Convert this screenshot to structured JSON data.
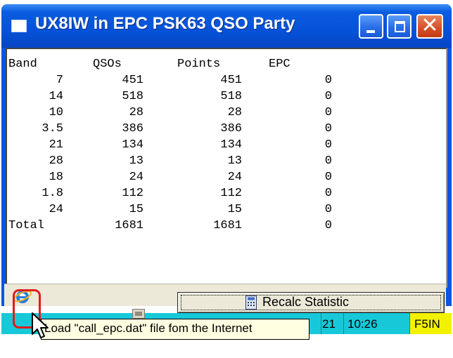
{
  "window": {
    "title": "UX8IW in EPC PSK63 QSO Party"
  },
  "stats_table": {
    "headers": [
      "Band",
      "QSOs",
      "Points",
      "EPC"
    ],
    "rows": [
      [
        "7",
        "451",
        "451",
        "0"
      ],
      [
        "14",
        "518",
        "518",
        "0"
      ],
      [
        "10",
        "28",
        "28",
        "0"
      ],
      [
        "3.5",
        "386",
        "386",
        "0"
      ],
      [
        "21",
        "134",
        "134",
        "0"
      ],
      [
        "28",
        "13",
        "13",
        "0"
      ],
      [
        "18",
        "24",
        "24",
        "0"
      ],
      [
        "1.8",
        "112",
        "112",
        "0"
      ],
      [
        "24",
        "15",
        "15",
        "0"
      ]
    ],
    "total": [
      "Total",
      "1681",
      "1681",
      "0"
    ]
  },
  "toolbar": {
    "recalc_label": "Recalc Statistic",
    "web_icon": "internet-explorer-icon"
  },
  "tooltip": {
    "text": "Load \"call_epc.dat\" file fom the Internet"
  },
  "status": {
    "number": "21",
    "time": "10:26",
    "call": "F5IN"
  },
  "colors": {
    "title_bar": "#0552d8",
    "status_strip": "#17c9d8",
    "call_highlight": "#f2f200",
    "highlight_ring": "#e21b1b"
  }
}
